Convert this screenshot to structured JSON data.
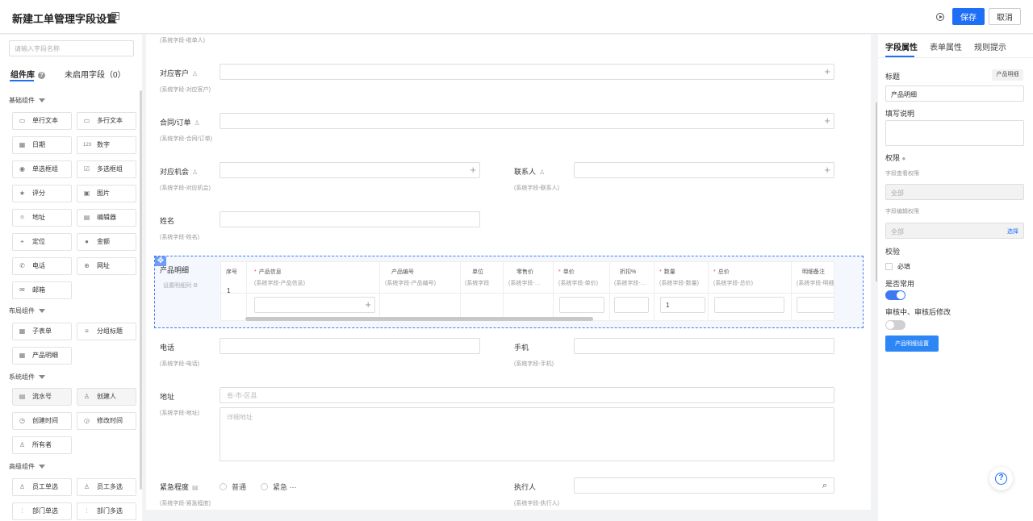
{
  "header": {
    "title": "新建工单管理字段设置",
    "save_label": "保存",
    "cancel_label": "取消"
  },
  "sidebar": {
    "search_placeholder": "请输入字段名称",
    "tabs": [
      {
        "label": "组件库",
        "active": true
      },
      {
        "label": "未启用字段（0）",
        "active": false
      }
    ],
    "groups": [
      {
        "title": "基础组件",
        "items": [
          {
            "label": "单行文本",
            "icon": "text-line-icon"
          },
          {
            "label": "多行文本",
            "icon": "textarea-icon"
          },
          {
            "label": "日期",
            "icon": "calendar-icon"
          },
          {
            "label": "数字",
            "icon": "number-icon"
          },
          {
            "label": "单选框组",
            "icon": "radio-icon"
          },
          {
            "label": "多选框组",
            "icon": "checkbox-icon"
          },
          {
            "label": "评分",
            "icon": "star-icon"
          },
          {
            "label": "图片",
            "icon": "image-icon"
          },
          {
            "label": "地址",
            "icon": "location-icon"
          },
          {
            "label": "编辑器",
            "icon": "editor-icon"
          },
          {
            "label": "定位",
            "icon": "map-pin-icon"
          },
          {
            "label": "金额",
            "icon": "money-icon"
          },
          {
            "label": "电话",
            "icon": "phone-icon"
          },
          {
            "label": "网址",
            "icon": "globe-icon"
          },
          {
            "label": "邮箱",
            "icon": "mail-icon"
          }
        ]
      },
      {
        "title": "布局组件",
        "items": [
          {
            "label": "子表单",
            "icon": "table-icon"
          },
          {
            "label": "分组标题",
            "icon": "group-title-icon"
          },
          {
            "label": "产品明细",
            "icon": "product-table-icon"
          }
        ]
      },
      {
        "title": "系统组件",
        "items": [
          {
            "label": "流水号",
            "icon": "serial-icon"
          },
          {
            "label": "创建人",
            "icon": "user-icon"
          },
          {
            "label": "创建时间",
            "icon": "clock-icon"
          },
          {
            "label": "修改时间",
            "icon": "clock-edit-icon"
          },
          {
            "label": "所有者",
            "icon": "owner-icon"
          }
        ]
      },
      {
        "title": "高级组件",
        "items": [
          {
            "label": "员工单选",
            "icon": "staff-icon"
          },
          {
            "label": "员工多选",
            "icon": "staff-multi-icon"
          },
          {
            "label": "部门单选",
            "icon": "dept-icon"
          },
          {
            "label": "部门多选",
            "icon": "dept-multi-icon"
          }
        ]
      }
    ]
  },
  "form": {
    "top_hint": "(系统字段-收单人)",
    "fields": {
      "customer": {
        "label": "对应客户",
        "hint": "(系统字段-对应客户)"
      },
      "contract": {
        "label": "合同/订单",
        "hint": "(系统字段-合同/订单)"
      },
      "opportunity": {
        "label": "对应机会",
        "hint": "(系统字段-对应机会)"
      },
      "contact": {
        "label": "联系人",
        "hint": "(系统字段-联系人)"
      },
      "name": {
        "label": "姓名",
        "hint": "(系统字段-姓名)"
      },
      "phone": {
        "label": "电话",
        "hint": "(系统字段-电话)"
      },
      "mobile": {
        "label": "手机",
        "hint": "(系统字段-手机)"
      },
      "address": {
        "label": "地址",
        "hint": "(系统字段-地址)",
        "placeholder_region": "省-市-区县",
        "placeholder_detail": "详细地址"
      },
      "urgency": {
        "label": "紧急程度",
        "hint": "(系统字段-紧急程度)",
        "options": [
          "普通",
          "紧急"
        ],
        "more": "···"
      },
      "executor": {
        "label": "执行人",
        "hint": "(系统字段-执行人)"
      }
    },
    "product_detail": {
      "label": "产品明细",
      "set_columns": "设置明细列",
      "row_number": "1",
      "columns": [
        {
          "title": "序号",
          "sub": "",
          "required": false
        },
        {
          "title": "产品信息",
          "sub": "(系统字段-产品信息)",
          "required": true
        },
        {
          "title": "产品编号",
          "sub": "(系统字段-产品编号)",
          "required": false
        },
        {
          "title": "单位",
          "sub": "(系统字段",
          "required": false
        },
        {
          "title": "零售价",
          "sub": "(系统字段-…",
          "required": false
        },
        {
          "title": "单价",
          "sub": "(系统字段-单价)",
          "required": true
        },
        {
          "title": "折扣%",
          "sub": "(系统字段-…",
          "required": false
        },
        {
          "title": "数量",
          "sub": "(系统字段-数量)",
          "required": true
        },
        {
          "title": "总价",
          "sub": "(系统字段-总价)",
          "required": true
        },
        {
          "title": "明细备注",
          "sub": "(系统字段-明细",
          "required": false
        }
      ],
      "quantity_value": "1"
    }
  },
  "props": {
    "tabs": [
      {
        "label": "字段属性",
        "active": true
      },
      {
        "label": "表单属性",
        "active": false
      },
      {
        "label": "规则提示",
        "active": false
      }
    ],
    "title_label": "标题",
    "type_tag": "产品明细",
    "title_value": "产品明细",
    "desc_label": "填写说明",
    "permission_label": "权限",
    "view_perm_label": "字段查看权限",
    "view_perm_value": "全部",
    "edit_perm_label": "字段编辑权限",
    "edit_perm_value": "全部",
    "select_label": "选择",
    "validate_label": "校验",
    "required_label": "必填",
    "common_label": "是否常用",
    "common_on": true,
    "review_label": "审核中、审核后修改",
    "review_on": false,
    "settings_button": "产品明细设置"
  },
  "colors": {
    "primary": "#1e6ff5",
    "selected_border": "#3f7bf0",
    "required": "#e34d4d"
  }
}
